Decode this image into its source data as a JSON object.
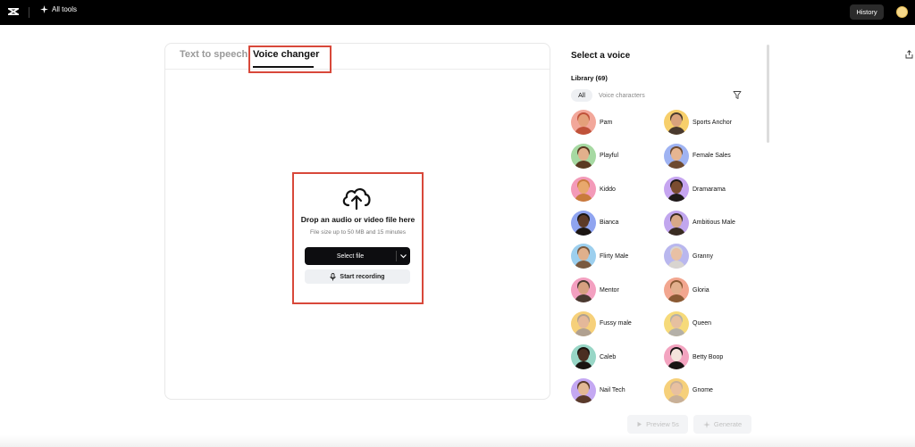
{
  "topbar": {
    "all_tools_label": "All tools",
    "history_label": "History"
  },
  "tabs": {
    "text_to_speech": "Text to speech",
    "voice_changer": "Voice changer"
  },
  "upload": {
    "title": "Drop an audio or video file here",
    "subtitle": "File size up to 50 MB and 15 minutes",
    "select_file_label": "Select file",
    "start_recording_label": "Start recording"
  },
  "voices_panel": {
    "title": "Select a voice",
    "library_label": "Library (69)",
    "filter_all": "All",
    "filter_voice_characters": "Voice characters",
    "voices": [
      {
        "name": "Pam",
        "bg": "#f2a79a",
        "skin": "#e4a07a",
        "hair": "#c0523a"
      },
      {
        "name": "Sports Anchor",
        "bg": "#f7cf6b",
        "skin": "#d9a27c",
        "hair": "#4a3a2e"
      },
      {
        "name": "Playful",
        "bg": "#a6d9a2",
        "skin": "#e2b08c",
        "hair": "#5a3a22"
      },
      {
        "name": "Female Sales",
        "bg": "#9fb3f2",
        "skin": "#e6b591",
        "hair": "#6e4a30"
      },
      {
        "name": "Kiddo",
        "bg": "#f39ab8",
        "skin": "#e8a86d",
        "hair": "#c97b3c"
      },
      {
        "name": "Dramarama",
        "bg": "#c6a5f0",
        "skin": "#7a4c30",
        "hair": "#1f1a18"
      },
      {
        "name": "Bianca",
        "bg": "#8fa4f0",
        "skin": "#5c3a28",
        "hair": "#1b1512"
      },
      {
        "name": "Ambitious Male",
        "bg": "#c1a6ee",
        "skin": "#d8a888",
        "hair": "#3a2c22"
      },
      {
        "name": "Flirty Male",
        "bg": "#9ccfee",
        "skin": "#e0b08c",
        "hair": "#7a5a40"
      },
      {
        "name": "Granny",
        "bg": "#b9b7ee",
        "skin": "#e8c0a4",
        "hair": "#d8d4d0"
      },
      {
        "name": "Mentor",
        "bg": "#f3a0c0",
        "skin": "#d6a080",
        "hair": "#4a3a30"
      },
      {
        "name": "Gloria",
        "bg": "#f2a68f",
        "skin": "#e2b08e",
        "hair": "#8a5a34"
      },
      {
        "name": "Fussy male",
        "bg": "#f6d07a",
        "skin": "#e4b89a",
        "hair": "#b0a090"
      },
      {
        "name": "Queen",
        "bg": "#f6da7a",
        "skin": "#e6c0a0",
        "hair": "#b4b0a8"
      },
      {
        "name": "Caleb",
        "bg": "#98d6c6",
        "skin": "#4a2e20",
        "hair": "#1a1410"
      },
      {
        "name": "Betty Boop",
        "bg": "#f3a4c0",
        "skin": "#f4e4dc",
        "hair": "#1a1414"
      },
      {
        "name": "Nail Tech",
        "bg": "#c4a8f2",
        "skin": "#e2b894",
        "hair": "#5a3a2a"
      },
      {
        "name": "Gnome",
        "bg": "#f6d07a",
        "skin": "#e8c0a0",
        "hair": "#c8b098"
      }
    ]
  },
  "actions": {
    "preview_label": "Preview 5s",
    "generate_label": "Generate"
  }
}
